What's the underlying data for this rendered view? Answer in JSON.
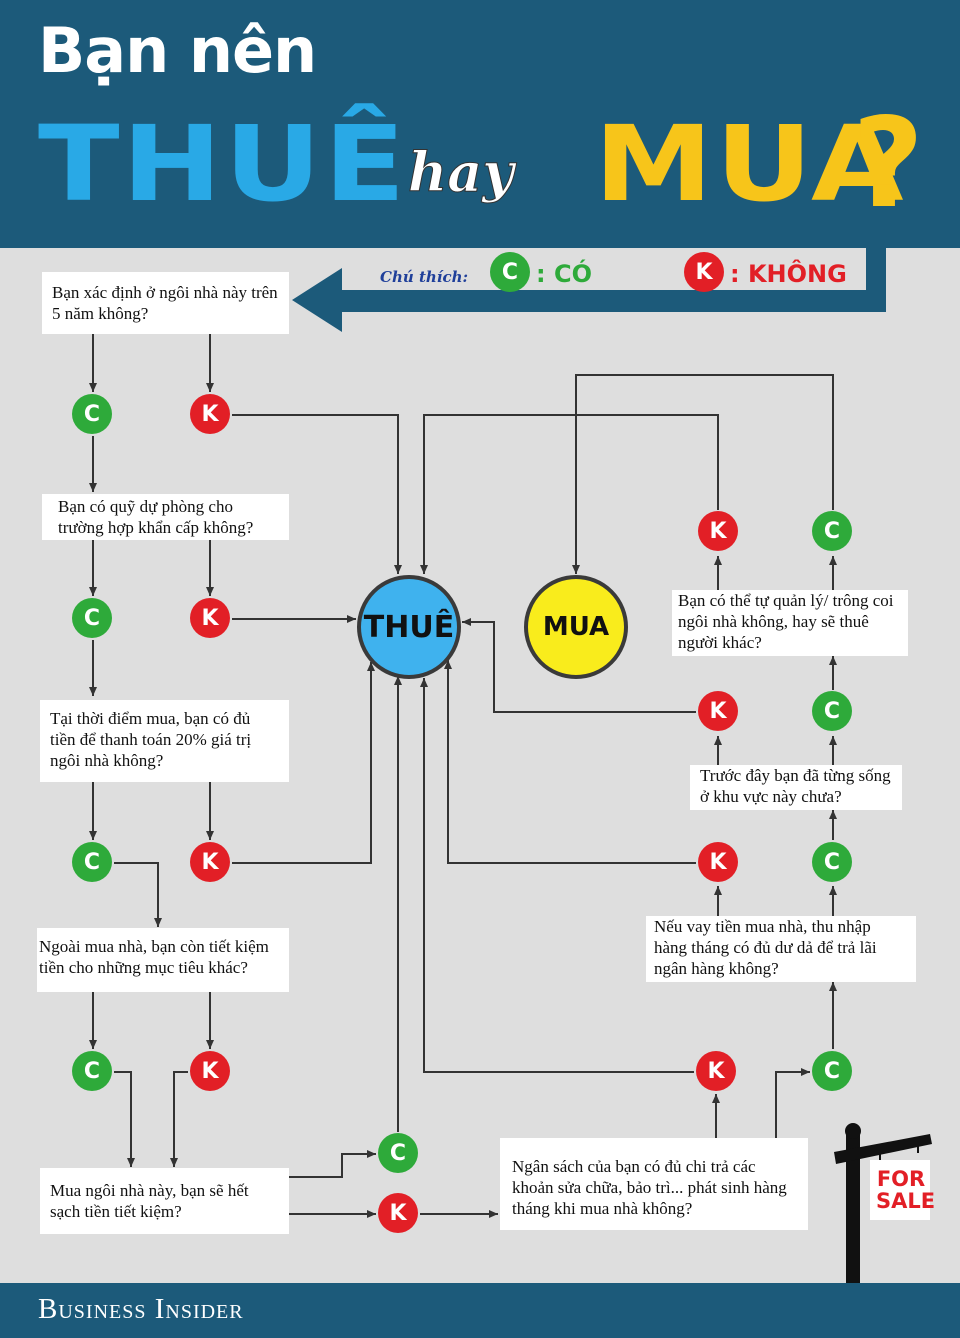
{
  "header": {
    "line1": "Bạn nên",
    "word_rent": "THUÊ",
    "word_or": "hay",
    "word_buy": "MUA",
    "question_mark": "?"
  },
  "legend": {
    "label": "Chú thích:",
    "yes_symbol": "C",
    "yes_text": ": CÓ",
    "no_symbol": "K",
    "no_text": ": KHÔNG"
  },
  "questions": {
    "q1": "Bạn xác định ở ngôi nhà này trên 5 năm không?",
    "q2": "Bạn có quỹ dự phòng cho trường hợp khẩn cấp không?",
    "q3": "Tại thời điểm mua, bạn có đủ tiền để thanh toán 20% giá trị ngôi nhà không?",
    "q4": "Ngoài mua nhà, bạn còn tiết kiệm tiền cho những mục tiêu khác?",
    "q5": "Mua ngôi nhà này, bạn sẽ hết sạch tiền tiết kiệm?",
    "q6": "Ngân sách của bạn có đủ chi trả các khoản sửa chữa, bảo trì... phát sinh hàng tháng khi mua nhà không?",
    "q7": "Nếu vay tiền mua nhà, thu nhập hàng tháng có đủ dư dả để trả lãi ngân hàng không?",
    "q8": "Trước đây bạn đã từng sống ở khu vực này chưa?",
    "q9": "Bạn có thể tự quản lý/ trông coi ngôi nhà không, hay sẽ thuê người khác?"
  },
  "outcomes": {
    "rent": "THUÊ",
    "buy": "MUA"
  },
  "node_labels": {
    "yes": "C",
    "no": "K"
  },
  "sign": {
    "line1": "FOR",
    "line2": "SALE"
  },
  "footer": {
    "brand": "Business Insider"
  },
  "colors": {
    "header_bg": "#1c5a7a",
    "page_bg": "#dedede",
    "yes": "#2eaa3a",
    "no": "#e21f26",
    "rent": "#29a9e6",
    "buy": "#f7c51a"
  }
}
